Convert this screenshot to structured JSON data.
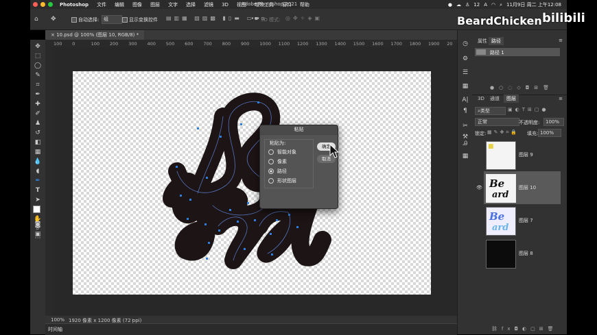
{
  "menubar": {
    "app_name": "Photoshop",
    "items": [
      "文件",
      "编辑",
      "图像",
      "图层",
      "文字",
      "选择",
      "滤镜",
      "3D",
      "视图",
      "增效工具",
      "窗口",
      "帮助"
    ],
    "window_title": "Adobe Photoshop 2021",
    "notif_count": "12",
    "datetime": "11月9日 周二 上午12:08"
  },
  "options_bar": {
    "auto_select_label": "自动选择:",
    "auto_select_value": "组",
    "show_transform_label": "显示变换控件",
    "mode_3d_label": "3D 模式:"
  },
  "document_tab": {
    "label": "10.psd @ 100% (图层 10, RGB/8) *"
  },
  "ruler": {
    "ticks": [
      "100",
      "0",
      "100",
      "200",
      "300",
      "400",
      "500",
      "600",
      "700",
      "800",
      "900",
      "1000",
      "1100",
      "1200",
      "1300",
      "1400",
      "1500",
      "1600",
      "1700",
      "1800",
      "1900",
      "20"
    ]
  },
  "status_bar": {
    "zoom": "100%",
    "doc_info": "1920 像素 x 1200 像素 (72 ppi)",
    "timeline_label": "时间轴"
  },
  "paths_panel": {
    "tabs": [
      "属性",
      "路径"
    ],
    "active_tab": "路径",
    "path_name": "路径 1"
  },
  "layers_panel": {
    "tabs": [
      "3D",
      "通道",
      "图层"
    ],
    "active_tab": "图层",
    "filter_label": "类型",
    "blend_mode": "正常",
    "opacity_label": "不透明度:",
    "opacity_value": "100%",
    "lock_label": "锁定:",
    "fill_label": "填充:",
    "fill_value": "100%",
    "layers": [
      {
        "name": "图层 9",
        "visible": false,
        "selected": false
      },
      {
        "name": "图层 10",
        "visible": true,
        "selected": true
      },
      {
        "name": "图层 7",
        "visible": false,
        "selected": false
      },
      {
        "name": "图层 8",
        "visible": false,
        "selected": false
      }
    ]
  },
  "paste_dialog": {
    "title": "粘贴",
    "group_label": "粘贴为:",
    "options": [
      "智能对象",
      "像素",
      "路径",
      "形状图层"
    ],
    "selected_option": "路径",
    "ok_label": "确定",
    "cancel_label": "取消"
  },
  "watermark": {
    "text": "BeardChicken",
    "logo": "bilibili"
  },
  "colors": {
    "accent": "#2d7fdc",
    "panel": "#323232",
    "canvas": "#282828",
    "ink": "#1d1415"
  }
}
